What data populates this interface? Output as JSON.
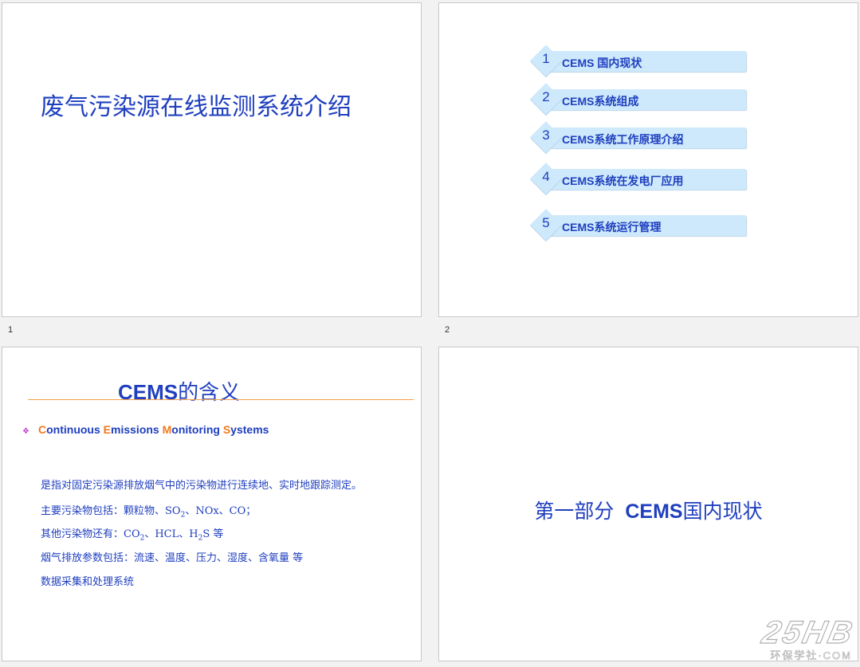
{
  "slides": [
    {
      "number": "1",
      "title": "废气污染源在线监测系统介绍"
    },
    {
      "number": "2",
      "toc": [
        {
          "num": "1",
          "label": "CEMS 国内现状"
        },
        {
          "num": "2",
          "label": "CEMS系统组成"
        },
        {
          "num": "3",
          "label": "CEMS系统工作原理介绍"
        },
        {
          "num": "4",
          "label": "CEMS系统在发电厂应用"
        },
        {
          "num": "5",
          "label": "CEMS系统运行管理"
        }
      ]
    },
    {
      "number": "",
      "title_en": "CEMS",
      "title_cn": "的含义",
      "bullet": "❖",
      "subtitle_parts": [
        {
          "cap": "C",
          "rest": "ontinuous "
        },
        {
          "cap": "E",
          "rest": "missions "
        },
        {
          "cap": "M",
          "rest": "onitoring "
        },
        {
          "cap": "S",
          "rest": "ystems"
        }
      ],
      "definition": "是指对固定污染源排放烟气中的污染物进行连续地、实时地跟踪测定。",
      "main_pollutants": {
        "a": "主要污染物包括：颗粒物、SO",
        "sub": "2",
        "b": "、NOx、CO；"
      },
      "other_pollutants": {
        "a": "其他污染物还有：CO",
        "sub1": "2",
        "b": "、HCL、H",
        "sub2": "2",
        "c": "S 等"
      },
      "flue_params": "烟气排放参数包括：流速、温度、压力、湿度、含氧量 等",
      "data_system": "数据采集和处理系统"
    },
    {
      "number": "",
      "part": "第一部分",
      "title_en": "CEMS",
      "title_cn": "国内现状"
    }
  ],
  "watermark": {
    "main": "25HB",
    "sub": "环保学社·COM"
  }
}
